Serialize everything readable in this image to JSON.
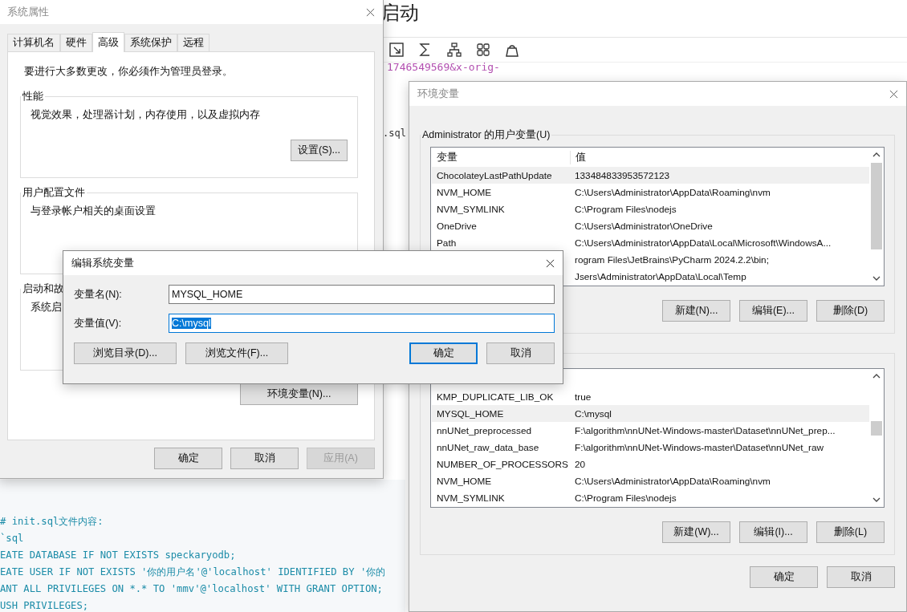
{
  "background": {
    "heading": "启动",
    "url_fragment": "1746549569&x-orig-",
    "file_fragment": ".sql",
    "code_lines": [
      "# init.sql文件内容:",
      "`sql",
      "EATE DATABASE IF NOT EXISTS speckaryodb;",
      "EATE USER IF NOT EXISTS '你的用户名'@'localhost' IDENTIFIED BY '你的",
      "ANT ALL PRIVILEGES ON *.* TO 'mmv'@'localhost' WITH GRANT OPTION;",
      "USH PRIVILEGES;"
    ]
  },
  "system_properties": {
    "title": "系统属性",
    "tabs": [
      {
        "label": "计算机名",
        "selected": false
      },
      {
        "label": "硬件",
        "selected": false
      },
      {
        "label": "高级",
        "selected": true
      },
      {
        "label": "系统保护",
        "selected": false
      },
      {
        "label": "远程",
        "selected": false
      }
    ],
    "notice": "要进行大多数更改，你必须作为管理员登录。",
    "groups": [
      {
        "title": "性能",
        "description": "视觉效果，处理器计划，内存使用，以及虚拟内存",
        "button": "设置(S)..."
      },
      {
        "title": "用户配置文件",
        "description": "与登录帐户相关的桌面设置"
      },
      {
        "title": "启动和故",
        "description": "系统启"
      }
    ],
    "env_button": "环境变量(N)...",
    "buttons": [
      {
        "label": "确定",
        "disabled": false
      },
      {
        "label": "取消",
        "disabled": false
      },
      {
        "label": "应用(A)",
        "disabled": true
      }
    ]
  },
  "environment_variables": {
    "title": "环境变量",
    "user_group": {
      "title": "Administrator 的用户变量(U)",
      "columns": [
        "变量",
        "值"
      ],
      "rows": [
        {
          "name": "ChocolateyLastPathUpdate",
          "value": "133484833953572123",
          "selected": true
        },
        {
          "name": "NVM_HOME",
          "value": "C:\\Users\\Administrator\\AppData\\Roaming\\nvm",
          "selected": false
        },
        {
          "name": "NVM_SYMLINK",
          "value": "C:\\Program Files\\nodejs",
          "selected": false
        },
        {
          "name": "OneDrive",
          "value": "C:\\Users\\Administrator\\OneDrive",
          "selected": false
        },
        {
          "name": "Path",
          "value": "C:\\Users\\Administrator\\AppData\\Local\\Microsoft\\WindowsA...",
          "selected": false
        },
        {
          "value": "rogram Files\\JetBrains\\PyCharm 2024.2.2\\bin;",
          "selected": false
        },
        {
          "value": "Jsers\\Administrator\\AppData\\Local\\Temp",
          "selected": false
        }
      ],
      "buttons": [
        "新建(N)...",
        "编辑(E)...",
        "删除(D)"
      ]
    },
    "system_group": {
      "rows": [
        {
          "name": "KMP_DUPLICATE_LIB_OK",
          "value": "true",
          "selected": false
        },
        {
          "name": "MYSQL_HOME",
          "value": "C:\\mysql",
          "selected": true
        },
        {
          "name": "nnUNet_preprocessed",
          "value": "F:\\algorithm\\nnUNet-Windows-master\\Dataset\\nnUNet_prep...",
          "selected": false
        },
        {
          "name": "nnUNet_raw_data_base",
          "value": "F:\\algorithm\\nnUNet-Windows-master\\Dataset\\nnUNet_raw",
          "selected": false
        },
        {
          "name": "NUMBER_OF_PROCESSORS",
          "value": "20",
          "selected": false
        },
        {
          "name": "NVM_HOME",
          "value": "C:\\Users\\Administrator\\AppData\\Roaming\\nvm",
          "selected": false
        },
        {
          "name": "NVM_SYMLINK",
          "value": "C:\\Program Files\\nodejs",
          "selected": false
        }
      ],
      "buttons": [
        "新建(W)...",
        "编辑(I)...",
        "删除(L)"
      ]
    },
    "buttons": [
      "确定",
      "取消"
    ]
  },
  "edit_dialog": {
    "title": "编辑系统变量",
    "fields": [
      {
        "label": "变量名(N):",
        "value": "MYSQL_HOME",
        "focused": false
      },
      {
        "label": "变量值(V):",
        "value": "C:\\mysql",
        "focused": true
      }
    ],
    "browse_buttons": [
      "浏览目录(D)...",
      "浏览文件(F)..."
    ],
    "buttons": [
      {
        "label": "确定",
        "default": true
      },
      {
        "label": "取消",
        "default": false
      }
    ]
  }
}
